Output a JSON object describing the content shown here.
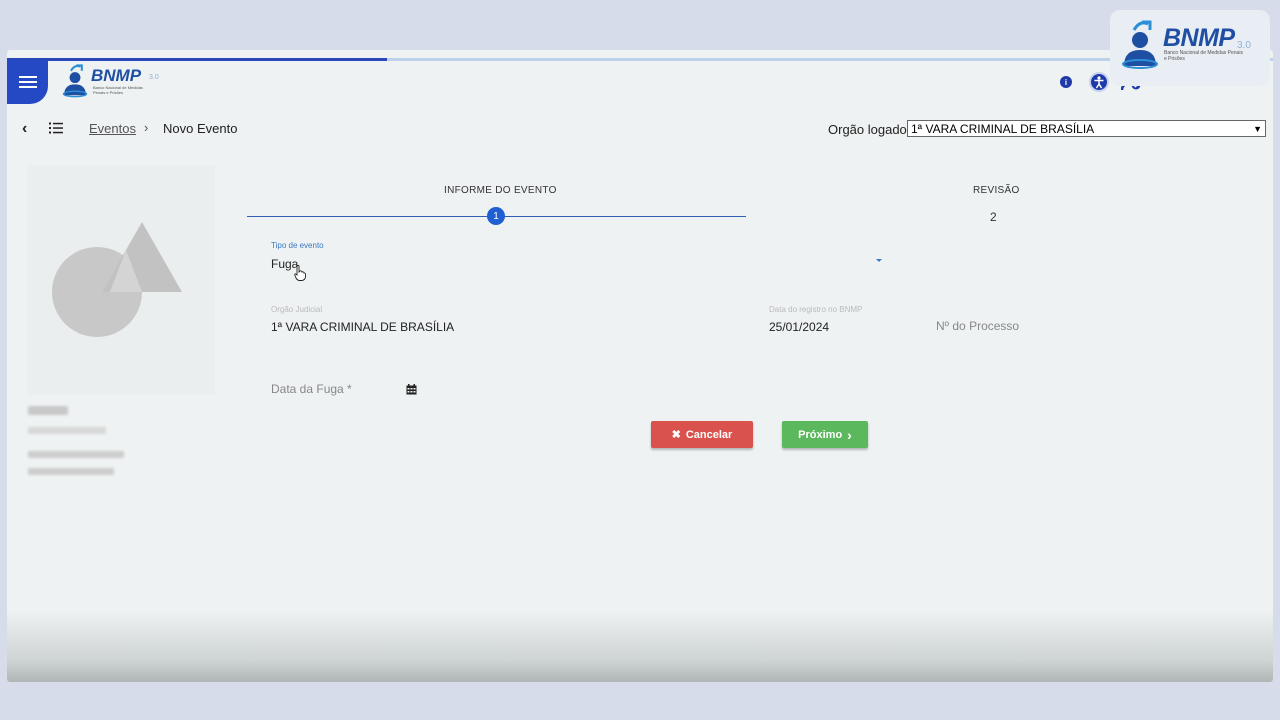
{
  "corner_logo": {
    "brand": "BNMP",
    "version": "3.0",
    "subtitle": "Banco Nacional de Medidas Penais e Prisões"
  },
  "header": {
    "brand": "BNMP",
    "version": "3.0",
    "subtitle": "Banco Nacional de Medidas Penais e Prisões",
    "progress_fraction": 0.3,
    "icons": [
      "menu-icon",
      "info-icon",
      "accessibility-icon",
      "user-check-icon"
    ]
  },
  "breadcrumb": {
    "link": "Eventos",
    "separator": "›",
    "current": "Novo Evento",
    "back_glyph": "‹"
  },
  "orgao": {
    "label": "Orgão logado:",
    "selected": "1ª VARA CRIMINAL DE BRASÍLIA"
  },
  "stepper": {
    "steps": [
      {
        "title": "INFORME DO EVENTO",
        "number": "1"
      },
      {
        "title": "REVISÃO",
        "number": "2"
      }
    ]
  },
  "form": {
    "tipo_evento": {
      "label": "Tipo de evento",
      "value": "Fuga"
    },
    "orgao_judicial": {
      "label": "Orgão Judicial",
      "value": "1ª VARA CRIMINAL DE BRASÍLIA"
    },
    "data_registro": {
      "label": "Data do registro no BNMP",
      "value": "25/01/2024"
    },
    "numero_processo": {
      "placeholder": "Nº do Processo"
    },
    "data_fuga": {
      "placeholder": "Data da Fuga *"
    }
  },
  "actions": {
    "cancel_label": "Cancelar",
    "cancel_icon": "✖",
    "next_label": "Próximo",
    "next_icon": "›"
  },
  "colors": {
    "primary": "#2548c5",
    "cancel": "#d9524e",
    "next": "#5cb85c"
  }
}
